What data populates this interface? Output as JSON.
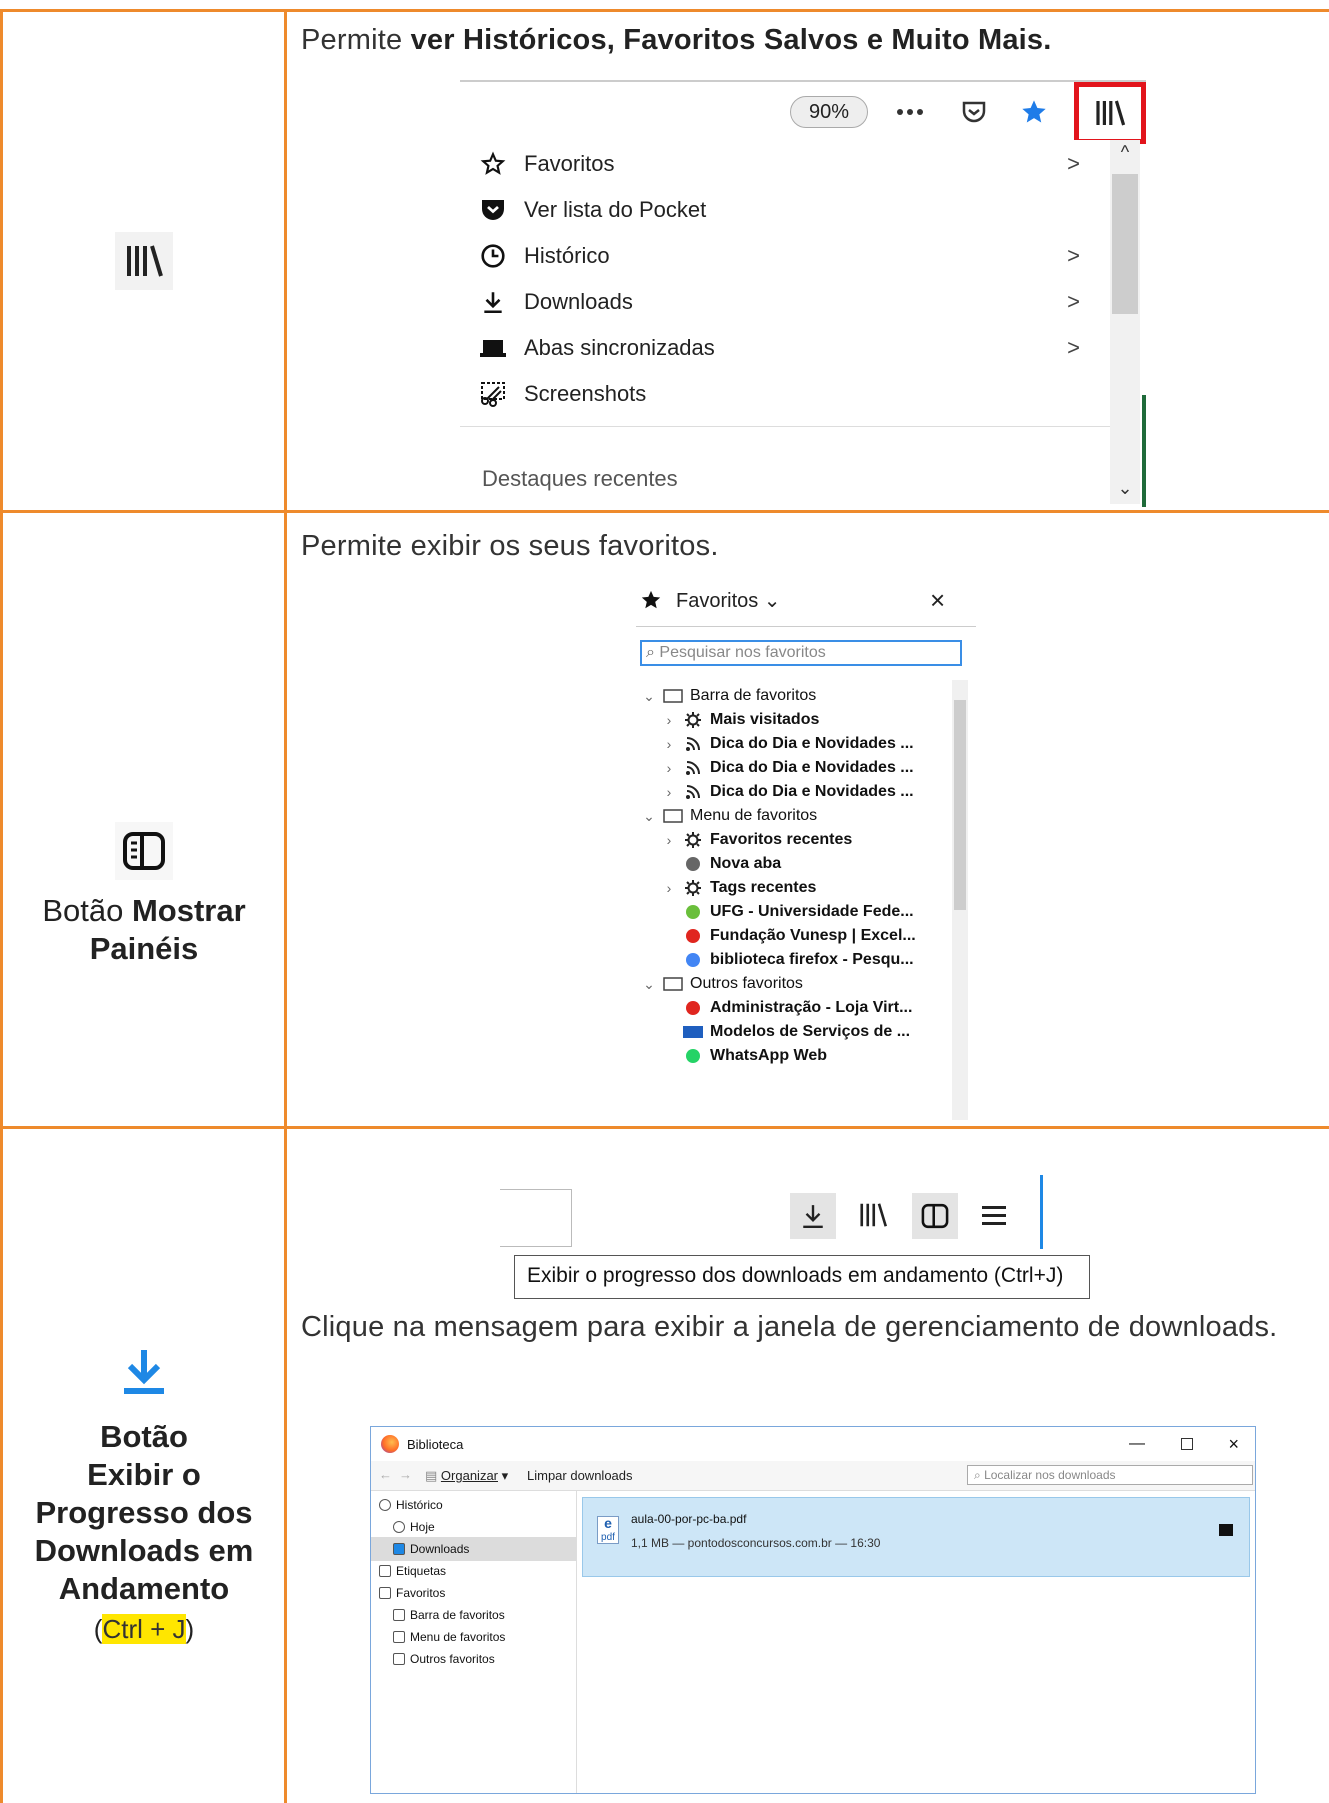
{
  "row1": {
    "desc_prefix": "Permite ",
    "desc_bold": "ver Históricos, Favoritos Salvos e Muito Mais.",
    "left_icon": "library-icon",
    "toolbar": {
      "zoom": "90%",
      "icons": [
        "more-icon",
        "pocket-icon",
        "star-icon",
        "library-icon"
      ]
    },
    "menu_items": [
      {
        "label": "Favoritos",
        "icon": "star-outline-icon",
        "submenu": true
      },
      {
        "label": "Ver lista do Pocket",
        "icon": "pocket-icon",
        "submenu": false
      },
      {
        "label": "Histórico",
        "icon": "clock-icon",
        "submenu": true
      },
      {
        "label": "Downloads",
        "icon": "download-icon",
        "submenu": true
      },
      {
        "label": "Abas sincronizadas",
        "icon": "synced-tabs-icon",
        "submenu": true
      },
      {
        "label": "Screenshots",
        "icon": "screenshot-icon",
        "submenu": false
      }
    ],
    "recent_label": "Destaques recentes",
    "chevron": ">"
  },
  "row2": {
    "desc": "Permite exibir os seus favoritos.",
    "left_prefix": "Botão ",
    "left_bold_1": "Mostrar",
    "left_bold_2": "Painéis",
    "panel": {
      "title": "Favoritos",
      "close": "×",
      "search_placeholder": "Pesquisar nos favoritos",
      "items": [
        {
          "label": "Barra de favoritos",
          "icon": "folder-star-icon",
          "twisty": "⌄"
        },
        {
          "label": "Mais visitados",
          "icon": "gear-icon",
          "twisty": "›"
        },
        {
          "label": "Dica do Dia e Novidades ...",
          "icon": "rss-icon",
          "twisty": "›"
        },
        {
          "label": "Dica do Dia e Novidades ...",
          "icon": "rss-icon",
          "twisty": "›"
        },
        {
          "label": "Dica do Dia e Novidades ...",
          "icon": "rss-icon",
          "twisty": "›"
        },
        {
          "label": "Menu de favoritos",
          "icon": "folder-list-icon",
          "twisty": "⌄"
        },
        {
          "label": "Favoritos recentes",
          "icon": "gear-icon",
          "twisty": "›"
        },
        {
          "label": "Nova aba",
          "icon": "globe-icon",
          "twisty": ""
        },
        {
          "label": "Tags recentes",
          "icon": "gear-icon",
          "twisty": "›"
        },
        {
          "label": "UFG - Universidade Fede...",
          "icon": "ufg-icon",
          "twisty": ""
        },
        {
          "label": "Fundação Vunesp | Excel...",
          "icon": "vunesp-icon",
          "twisty": ""
        },
        {
          "label": "biblioteca firefox - Pesqu...",
          "icon": "google-icon",
          "twisty": ""
        },
        {
          "label": "Outros favoritos",
          "icon": "folder-other-icon",
          "twisty": "⌄"
        },
        {
          "label": "Administração - Loja Virt...",
          "icon": "target-icon",
          "twisty": ""
        },
        {
          "label": "Modelos de Serviços de ...",
          "icon": "ibm-icon",
          "twisty": ""
        },
        {
          "label": "WhatsApp Web",
          "icon": "whatsapp-icon",
          "twisty": ""
        }
      ]
    }
  },
  "row3": {
    "tooltip": "Exibir o progresso dos downloads em andamento (Ctrl+J)",
    "desc": "Clique na mensagem para exibir a janela de gerenciamento de downloads.",
    "left_bold": [
      "Botão",
      "Exibir o",
      "Progresso dos",
      "Downloads em",
      "Andamento"
    ],
    "shortcut_open": "(",
    "shortcut_ctrl": "Ctrl",
    "shortcut_plus": " + ",
    "shortcut_j": "J",
    "shortcut_close": ")",
    "window": {
      "title": "Biblioteca",
      "organize": "Organizar",
      "clear": "Limpar downloads",
      "search_placeholder": "Localizar nos downloads",
      "tree": [
        {
          "label": "Histórico",
          "level": 0
        },
        {
          "label": "Hoje",
          "level": 1
        },
        {
          "label": "Downloads",
          "level": 1,
          "selected": true
        },
        {
          "label": "Etiquetas",
          "level": 0
        },
        {
          "label": "Favoritos",
          "level": 0
        },
        {
          "label": "Barra de favoritos",
          "level": 1
        },
        {
          "label": "Menu de favoritos",
          "level": 1
        },
        {
          "label": "Outros favoritos",
          "level": 1
        }
      ],
      "download": {
        "filename": "aula-00-por-pc-ba.pdf",
        "meta": "1,1 MB — pontodosconcursos.com.br — 16:30",
        "filetype": "pdf"
      }
    }
  },
  "colors": {
    "border": "#ee8a2c",
    "highlight": "#e2141c",
    "accent": "#3a8ee6"
  }
}
